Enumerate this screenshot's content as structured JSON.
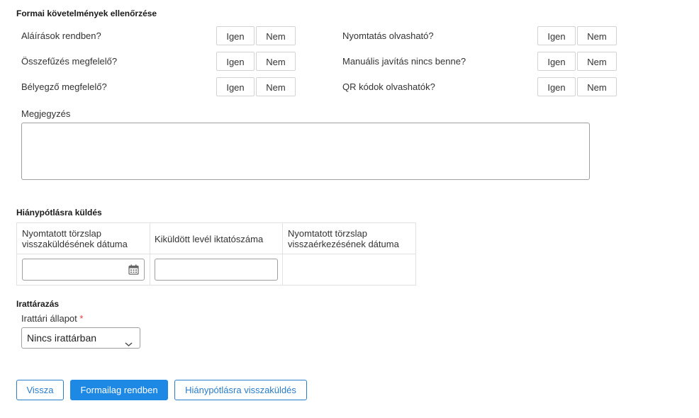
{
  "formal": {
    "title": "Formai követelmények ellenőrzése",
    "yes": "Igen",
    "no": "Nem",
    "questions": [
      "Aláírások rendben?",
      "Összefűzés megfelelő?",
      "Bélyegző megfelelő?",
      "Nyomtatás olvasható?",
      "Manuális javítás nincs benne?",
      "QR kódok olvashatók?"
    ],
    "note_label": "Megjegyzés",
    "note_value": ""
  },
  "deficiency": {
    "title": "Hiánypótlásra küldés",
    "columns": [
      "Nyomtatott törzslap visszaküldésének dátuma",
      "Kiküldött levél iktatószáma",
      "Nyomtatott törzslap visszaérkezésének dátuma"
    ],
    "send_date": "",
    "letter_number": ""
  },
  "archive": {
    "title": "Irattárazás",
    "status_label": "Irattári állapot",
    "required_mark": "*",
    "status_value": "Nincs irattárban"
  },
  "actions": {
    "back": "Vissza",
    "ok": "Formailag rendben",
    "send_back": "Hiánypótlásra visszaküldés"
  },
  "colors": {
    "primary": "#1e88e5",
    "outline": "#2a7dc9",
    "required": "#e53935"
  }
}
